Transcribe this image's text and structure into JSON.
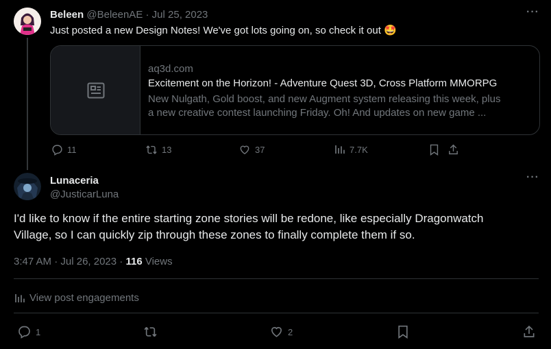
{
  "post1": {
    "author_name": "Beleen",
    "handle": "@BeleenAE",
    "separator": "·",
    "date": "Jul 25, 2023",
    "text": "Just posted a new Design Notes! We've got lots going on, so check it out",
    "emoji": "🤩",
    "card": {
      "domain": "aq3d.com",
      "title": "Excitement on the Horizon! - Adventure Quest 3D, Cross Platform MMORPG",
      "desc_line1": "New Nulgath, Gold boost, and new Augment system releasing this week, plus",
      "desc_line2": "a new creative contest launching Friday. Oh! And updates on new game ..."
    },
    "stats": {
      "replies": "11",
      "reposts": "13",
      "likes": "37",
      "views": "7.7K"
    }
  },
  "post2": {
    "author_name": "Lunaceria",
    "handle": "@JusticarLuna",
    "text_line1": "I'd like to know if the entire starting zone stories will be redone, like especially Dragonwatch",
    "text_line2": "Village, so I can quickly zip through these zones to finally complete them if so.",
    "time": "3:47 AM",
    "date": "Jul 26, 2023",
    "separator": "·",
    "views_count": "116",
    "views_label": "Views",
    "engagements_label": "View post engagements",
    "stats": {
      "replies": "1",
      "likes": "2"
    }
  },
  "more_glyph": "···",
  "icons": [
    "news-icon",
    "reply-icon",
    "repost-icon",
    "like-icon",
    "views-icon",
    "bookmark-icon",
    "share-icon",
    "more-icon"
  ],
  "colors": {
    "background": "#000000",
    "text": "#e7e9ea",
    "muted": "#71767b",
    "border": "#2f3336"
  }
}
